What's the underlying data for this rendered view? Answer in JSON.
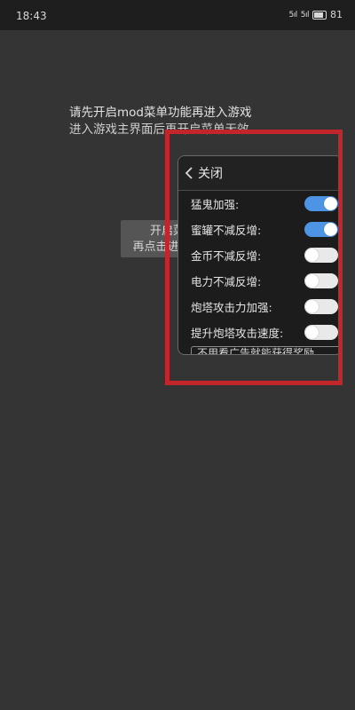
{
  "status_bar": {
    "time": "18:43",
    "signal1": "5ıl",
    "signal2": "5ıl",
    "battery": "81"
  },
  "instructions": {
    "line1": "请先开启mod菜单功能再进入游戏",
    "line2": "进入游戏主界面后再开启菜单无效"
  },
  "open_button": {
    "line1": "开启菜单",
    "line2": "再点击进入游戏"
  },
  "menu": {
    "title": "关闭",
    "items": [
      {
        "label": "猛鬼加强:",
        "on": true
      },
      {
        "label": "蜜罐不减反增:",
        "on": true
      },
      {
        "label": "金币不减反增:",
        "on": false
      },
      {
        "label": "电力不减反增:",
        "on": false
      },
      {
        "label": "炮塔攻击力加强:",
        "on": false
      },
      {
        "label": "提升炮塔攻击速度:",
        "on": false
      }
    ],
    "more_text": "不用看广告就能获得奖励"
  },
  "colors": {
    "highlight_border": "#c2262b",
    "toggle_on": "#4e94e4",
    "toggle_off": "#e9e9e9"
  }
}
